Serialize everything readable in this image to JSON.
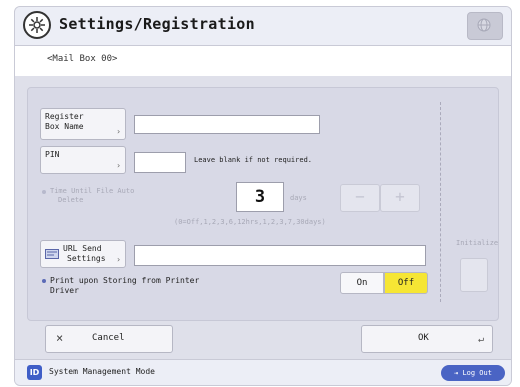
{
  "header": {
    "title": "Settings/Registration",
    "icon": "settings-gear-icon",
    "top_right_icon": "sphere-icon"
  },
  "mailbox": {
    "label": "<Mail Box 00>"
  },
  "form": {
    "register_box_name": {
      "label_line1": "Register",
      "label_line2": "Box Name",
      "value": ""
    },
    "pin": {
      "label": "PIN",
      "value": "",
      "hint": "Leave blank if not required."
    },
    "auto_delete": {
      "label_line1": "Time Until File Auto",
      "label_line2": "Delete",
      "value": "3",
      "unit": "days",
      "range_hint": "(0=Off,1,2,3,6,12hrs,1,2,3,7,30days)",
      "minus": "−",
      "plus": "+"
    },
    "url_send": {
      "label_line1": "URL Send",
      "label_line2": "Settings",
      "value": ""
    },
    "print_driver": {
      "label_line1": "Print upon Storing from Printer",
      "label_line2": "Driver",
      "on_label": "On",
      "off_label": "Off",
      "selected": "Off"
    },
    "initialize_label": "Initialize"
  },
  "buttons": {
    "cancel_icon": "×",
    "cancel_label": "Cancel",
    "ok_label": "OK",
    "ok_enter_icon": "↵"
  },
  "status": {
    "icon_text": "ID",
    "mode": "System Management Mode",
    "logout_label": "Log Out"
  },
  "colors": {
    "accent_yellow": "#f6e634",
    "panel_bg": "#d8d9e6",
    "status_blue": "#3f5ec7"
  }
}
